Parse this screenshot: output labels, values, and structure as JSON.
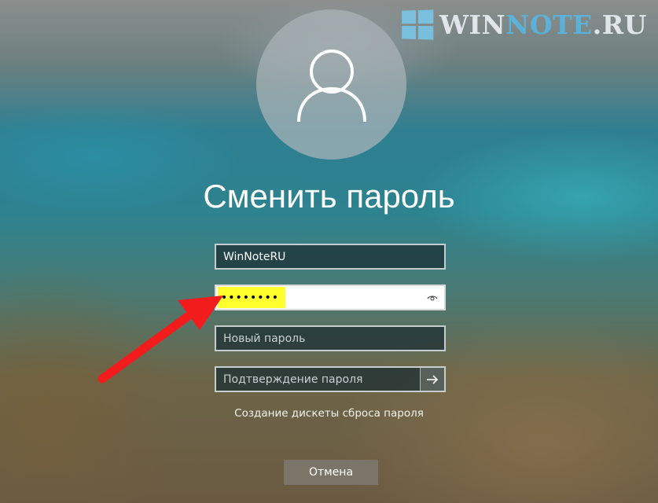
{
  "watermark": {
    "text_part1": "WIN",
    "text_part2": "NOTE",
    "text_part3": ".RU"
  },
  "title": "Сменить пароль",
  "fields": {
    "username": {
      "value": "WinNoteRU"
    },
    "old_password": {
      "value": "••••••••",
      "reveal_icon": "eye-icon"
    },
    "new_password": {
      "placeholder": "Новый пароль"
    },
    "confirm_password": {
      "placeholder": "Подтверждение пароля",
      "submit_icon": "arrow-right-icon"
    }
  },
  "reset_disk_link": "Создание дискеты сброса пароля",
  "cancel_button": "Отмена",
  "annotation": {
    "arrow_color": "#f21c1c",
    "highlight_color": "#ffff2e"
  }
}
